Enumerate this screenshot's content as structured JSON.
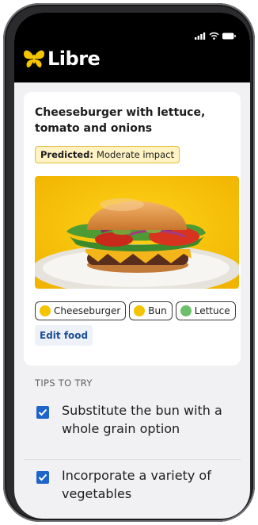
{
  "app": {
    "name": "Libre"
  },
  "food": {
    "title": "Cheeseburger with lettuce, tomato and onions",
    "prediction_label": "Predicted:",
    "prediction_value": "Moderate impact",
    "ingredients": [
      {
        "label": "Cheeseburger",
        "color": "#f5c400"
      },
      {
        "label": "Bun",
        "color": "#f5c400"
      },
      {
        "label": "Lettuce",
        "color": "#6cc06a"
      }
    ],
    "edit_label": "Edit food"
  },
  "tips": {
    "heading": "TIPS TO TRY",
    "items": [
      {
        "text": "Substitute the bun with a whole grain option",
        "checked": true
      },
      {
        "text": "Incorporate a variety of vegetables",
        "checked": true
      }
    ]
  },
  "colors": {
    "header_bg": "#000000",
    "logo_icon": "#f5c400",
    "badge_bg": "#fff3c4",
    "badge_border": "#e3b93c",
    "checkbox": "#1f64c8",
    "link": "#1f4f96"
  }
}
